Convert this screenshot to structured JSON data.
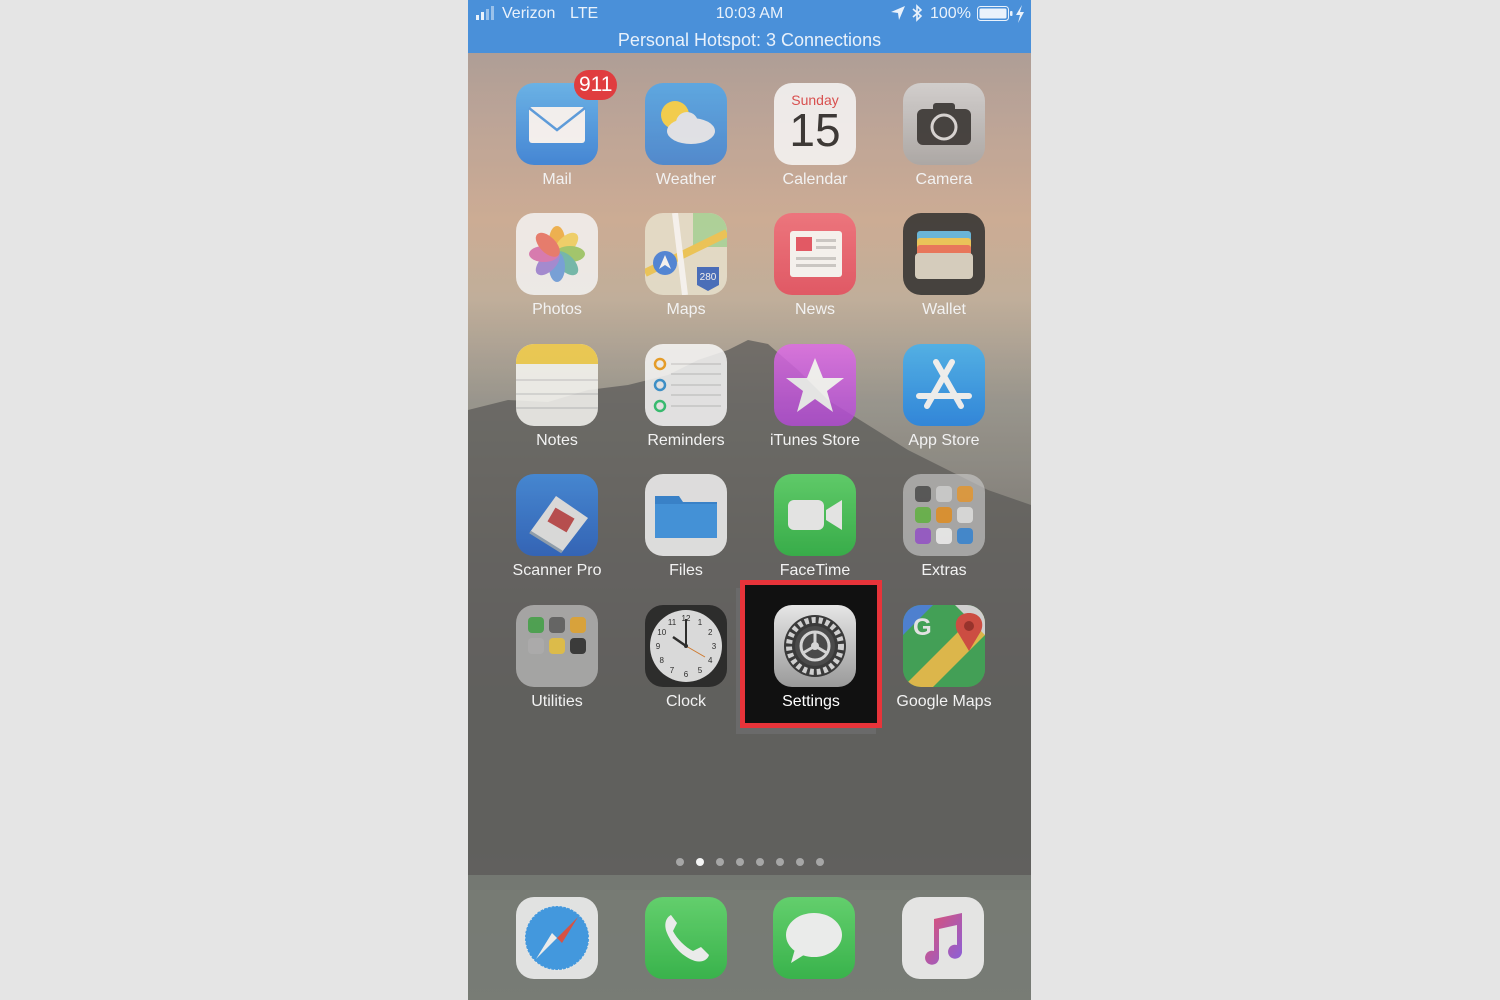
{
  "status_bar": {
    "carrier": "Verizon",
    "network": "LTE",
    "time": "10:03 AM",
    "battery_percent": "100%",
    "hotspot": "Personal Hotspot: 3 Connections",
    "bar_color": "#4a90d9"
  },
  "calendar": {
    "day_name": "Sunday",
    "day_number": "15"
  },
  "apps": [
    {
      "label": "Mail",
      "icon": "mail-icon",
      "badge": "911"
    },
    {
      "label": "Weather",
      "icon": "weather-icon"
    },
    {
      "label": "Calendar",
      "icon": "calendar-icon"
    },
    {
      "label": "Camera",
      "icon": "camera-icon"
    },
    {
      "label": "Photos",
      "icon": "photos-icon"
    },
    {
      "label": "Maps",
      "icon": "maps-icon",
      "shield": "280"
    },
    {
      "label": "News",
      "icon": "news-icon"
    },
    {
      "label": "Wallet",
      "icon": "wallet-icon"
    },
    {
      "label": "Notes",
      "icon": "notes-icon"
    },
    {
      "label": "Reminders",
      "icon": "reminders-icon"
    },
    {
      "label": "iTunes Store",
      "icon": "itunes-store-icon"
    },
    {
      "label": "App Store",
      "icon": "app-store-icon"
    },
    {
      "label": "Scanner Pro",
      "icon": "scanner-icon"
    },
    {
      "label": "Files",
      "icon": "files-icon"
    },
    {
      "label": "FaceTime",
      "icon": "facetime-icon"
    },
    {
      "label": "Extras",
      "icon": "folder-icon"
    },
    {
      "label": "Utilities",
      "icon": "folder-icon"
    },
    {
      "label": "Clock",
      "icon": "clock-icon"
    },
    {
      "label": "Settings",
      "icon": "gear-icon"
    },
    {
      "label": "Google Maps",
      "icon": "google-maps-icon"
    }
  ],
  "clock_numbers": [
    "12",
    "1",
    "2",
    "3",
    "4",
    "5",
    "6",
    "7",
    "8",
    "9",
    "10",
    "11"
  ],
  "page_dots": {
    "count": 8,
    "active_index": 1
  },
  "dock": [
    {
      "name": "Safari",
      "icon": "safari-icon"
    },
    {
      "name": "Phone",
      "icon": "phone-icon"
    },
    {
      "name": "Messages",
      "icon": "messages-icon"
    },
    {
      "name": "Music",
      "icon": "music-icon"
    }
  ],
  "highlight_color": "#e8343a"
}
